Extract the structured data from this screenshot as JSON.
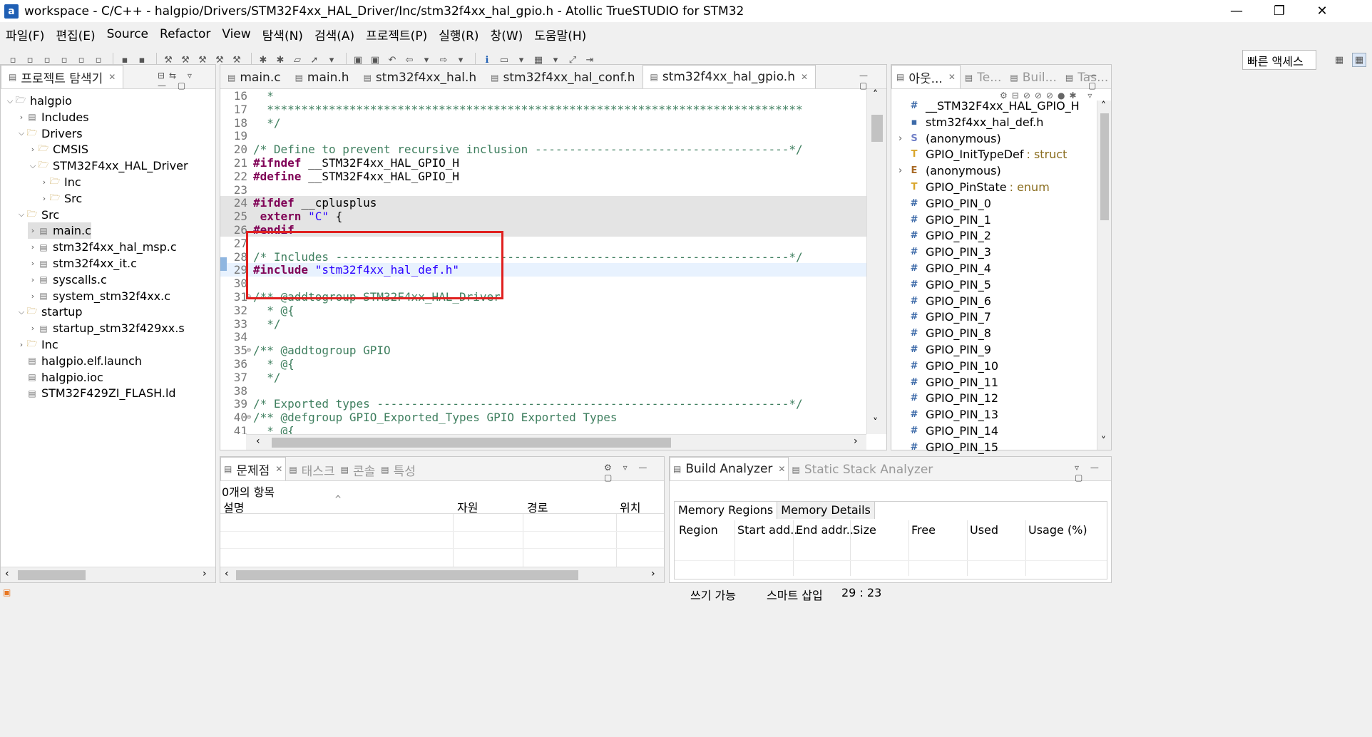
{
  "window": {
    "title": "workspace - C/C++ - halgpio/Drivers/STM32F4xx_HAL_Driver/Inc/stm32f4xx_hal_gpio.h - Atollic TrueSTUDIO for STM32",
    "app_icon": "a"
  },
  "menu": [
    "파일(F)",
    "편집(E)",
    "Source",
    "Refactor",
    "View",
    "탐색(N)",
    "검색(A)",
    "프로젝트(P)",
    "실행(R)",
    "창(W)",
    "도움말(H)"
  ],
  "quick_access": "빠른 액세스",
  "project_explorer": {
    "tab_label": "프로젝트 탐색기",
    "items": [
      {
        "label": "halgpio",
        "depth": 0,
        "twist": "v",
        "icon": "project"
      },
      {
        "label": "Includes",
        "depth": 1,
        "twist": ">",
        "icon": "includes"
      },
      {
        "label": "Drivers",
        "depth": 1,
        "twist": "v",
        "icon": "folder"
      },
      {
        "label": "CMSIS",
        "depth": 2,
        "twist": ">",
        "icon": "folder"
      },
      {
        "label": "STM32F4xx_HAL_Driver",
        "depth": 2,
        "twist": "v",
        "icon": "folder"
      },
      {
        "label": "Inc",
        "depth": 3,
        "twist": ">",
        "icon": "folder"
      },
      {
        "label": "Src",
        "depth": 3,
        "twist": ">",
        "icon": "folder"
      },
      {
        "label": "Src",
        "depth": 1,
        "twist": "v",
        "icon": "folder"
      },
      {
        "label": "main.c",
        "depth": 2,
        "twist": ">",
        "icon": "file",
        "selected": true
      },
      {
        "label": "stm32f4xx_hal_msp.c",
        "depth": 2,
        "twist": ">",
        "icon": "file"
      },
      {
        "label": "stm32f4xx_it.c",
        "depth": 2,
        "twist": ">",
        "icon": "file"
      },
      {
        "label": "syscalls.c",
        "depth": 2,
        "twist": ">",
        "icon": "file"
      },
      {
        "label": "system_stm32f4xx.c",
        "depth": 2,
        "twist": ">",
        "icon": "file"
      },
      {
        "label": "startup",
        "depth": 1,
        "twist": "v",
        "icon": "folder"
      },
      {
        "label": "startup_stm32f429xx.s",
        "depth": 2,
        "twist": ">",
        "icon": "file"
      },
      {
        "label": "Inc",
        "depth": 1,
        "twist": ">",
        "icon": "folder"
      },
      {
        "label": "halgpio.elf.launch",
        "depth": 1,
        "twist": "",
        "icon": "file"
      },
      {
        "label": "halgpio.ioc",
        "depth": 1,
        "twist": "",
        "icon": "file"
      },
      {
        "label": "STM32F429ZI_FLASH.ld",
        "depth": 1,
        "twist": "",
        "icon": "file"
      }
    ]
  },
  "editor": {
    "tabs": [
      {
        "label": "main.c",
        "active": false
      },
      {
        "label": "main.h",
        "active": false
      },
      {
        "label": "stm32f4xx_hal.h",
        "active": false
      },
      {
        "label": "stm32f4xx_hal_conf.h",
        "active": false
      },
      {
        "label": "stm32f4xx_hal_gpio.h",
        "active": true
      }
    ],
    "lines": [
      {
        "n": "16",
        "html": "<span class='cm'>  *</span>"
      },
      {
        "n": "17",
        "html": "<span class='cm'>  ******************************************************************************</span>"
      },
      {
        "n": "18",
        "html": "<span class='cm'>  */</span>"
      },
      {
        "n": "19",
        "html": ""
      },
      {
        "n": "20",
        "html": "<span class='cm'>/* Define to prevent recursive inclusion -------------------------------------*/</span>"
      },
      {
        "n": "21",
        "html": "<span class='kw'>#ifndef</span> __STM32F4xx_HAL_GPIO_H"
      },
      {
        "n": "22",
        "html": "<span class='kw'>#define</span> __STM32F4xx_HAL_GPIO_H"
      },
      {
        "n": "23",
        "html": ""
      },
      {
        "n": "24",
        "html": "<span class='kw'>#ifdef</span> __cplusplus",
        "bg": "hl"
      },
      {
        "n": "25",
        "html": " <span class='kw'>extern</span> <span class='str'>\"C\"</span> {",
        "bg": "hl"
      },
      {
        "n": "26",
        "html": "<span class='kw'>#endif</span>",
        "bg": "hl"
      },
      {
        "n": "27",
        "html": ""
      },
      {
        "n": "28",
        "html": "<span class='cm'>/* Includes ------------------------------------------------------------------*/</span>"
      },
      {
        "n": "29",
        "html": "<span class='kw'>#include</span> <span class='str'>\"stm32f4xx_hal_def.h\"</span>",
        "bg": "curline"
      },
      {
        "n": "30",
        "html": ""
      },
      {
        "n": "31",
        "html": "<span class='cm'>/** @addtogroup STM32F4xx_HAL_Driver</span>",
        "fold": true
      },
      {
        "n": "32",
        "html": "<span class='cm'>  * @{</span>"
      },
      {
        "n": "33",
        "html": "<span class='cm'>  */</span>"
      },
      {
        "n": "34",
        "html": ""
      },
      {
        "n": "35",
        "html": "<span class='cm'>/** @addtogroup GPIO</span>",
        "fold": true
      },
      {
        "n": "36",
        "html": "<span class='cm'>  * @{</span>"
      },
      {
        "n": "37",
        "html": "<span class='cm'>  */</span>"
      },
      {
        "n": "38",
        "html": ""
      },
      {
        "n": "39",
        "html": "<span class='cm'>/* Exported types ------------------------------------------------------------*/</span>"
      },
      {
        "n": "40",
        "html": "<span class='cm'>/** @defgroup GPIO_Exported_Types GPIO Exported Types</span>",
        "fold": true
      },
      {
        "n": "41",
        "html": "<span class='cm'>  * @{</span>"
      }
    ]
  },
  "outline": {
    "tabs": [
      "아웃...",
      "Te...",
      "Buil...",
      "Tas..."
    ],
    "items": [
      {
        "label": "__STM32F4xx_HAL_GPIO_H",
        "icon": "#",
        "color": "#3d6aa8"
      },
      {
        "label": "stm32f4xx_hal_def.h",
        "icon": "▪",
        "color": "#3d6aa8"
      },
      {
        "label": "(anonymous)",
        "icon": "S",
        "color": "#6f7ec6",
        "twist": ">"
      },
      {
        "label": "GPIO_InitTypeDef",
        "type": ": struct",
        "icon": "T",
        "color": "#d9a52b"
      },
      {
        "label": "(anonymous)",
        "icon": "E",
        "color": "#a86a26",
        "twist": ">"
      },
      {
        "label": "GPIO_PinState",
        "type": ": enum",
        "icon": "T",
        "color": "#d9a52b"
      },
      {
        "label": "GPIO_PIN_0",
        "icon": "#",
        "color": "#3d6aa8"
      },
      {
        "label": "GPIO_PIN_1",
        "icon": "#",
        "color": "#3d6aa8"
      },
      {
        "label": "GPIO_PIN_2",
        "icon": "#",
        "color": "#3d6aa8"
      },
      {
        "label": "GPIO_PIN_3",
        "icon": "#",
        "color": "#3d6aa8"
      },
      {
        "label": "GPIO_PIN_4",
        "icon": "#",
        "color": "#3d6aa8"
      },
      {
        "label": "GPIO_PIN_5",
        "icon": "#",
        "color": "#3d6aa8"
      },
      {
        "label": "GPIO_PIN_6",
        "icon": "#",
        "color": "#3d6aa8"
      },
      {
        "label": "GPIO_PIN_7",
        "icon": "#",
        "color": "#3d6aa8"
      },
      {
        "label": "GPIO_PIN_8",
        "icon": "#",
        "color": "#3d6aa8"
      },
      {
        "label": "GPIO_PIN_9",
        "icon": "#",
        "color": "#3d6aa8"
      },
      {
        "label": "GPIO_PIN_10",
        "icon": "#",
        "color": "#3d6aa8"
      },
      {
        "label": "GPIO_PIN_11",
        "icon": "#",
        "color": "#3d6aa8"
      },
      {
        "label": "GPIO_PIN_12",
        "icon": "#",
        "color": "#3d6aa8"
      },
      {
        "label": "GPIO_PIN_13",
        "icon": "#",
        "color": "#3d6aa8"
      },
      {
        "label": "GPIO_PIN_14",
        "icon": "#",
        "color": "#3d6aa8"
      },
      {
        "label": "GPIO_PIN_15",
        "icon": "#",
        "color": "#3d6aa8"
      }
    ]
  },
  "problems": {
    "tabs": [
      "문제점",
      "태스크",
      "콘솔",
      "특성"
    ],
    "count_text": "0개의 항목",
    "columns": [
      "설명",
      "자원",
      "경로",
      "위치"
    ]
  },
  "build_analyzer": {
    "tabs": [
      "Build Analyzer",
      "Static Stack Analyzer"
    ],
    "subtabs": [
      "Memory Regions",
      "Memory Details"
    ],
    "columns": [
      "Region",
      "Start add...",
      "End addr...",
      "Size",
      "Free",
      "Used",
      "Usage (%)"
    ]
  },
  "status": {
    "writable": "쓰기 가능",
    "insert_mode": "스마트 삽입",
    "position": "29 : 23"
  },
  "colors": {
    "highlight_box": "#e0201f",
    "keyword": "#7f0055",
    "comment": "#3f7f5f",
    "string": "#2a00ff"
  }
}
